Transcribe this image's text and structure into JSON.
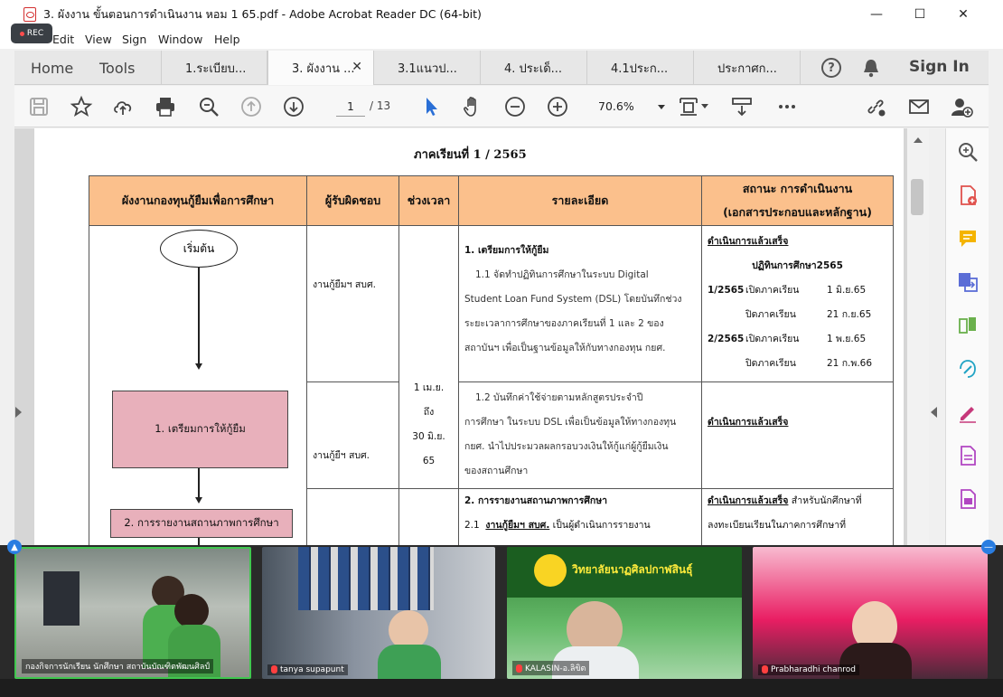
{
  "window": {
    "title": "3. ผังงาน ขั้นตอนการดำเนินงาน หอม 1 65.pdf - Adobe Acrobat Reader DC (64-bit)",
    "rec_label": "REC",
    "minimize": "—",
    "maximize": "☐",
    "close": "✕"
  },
  "menu": [
    "Edit",
    "View",
    "Sign",
    "Window",
    "Help"
  ],
  "nav": {
    "home": "Home",
    "tools": "Tools",
    "sign_in": "Sign In",
    "help": "?"
  },
  "tabs": [
    {
      "label": "1.ระเบียบ..."
    },
    {
      "label": "3. ผังงาน ...",
      "active": true,
      "close": "✕"
    },
    {
      "label": "3.1แนวป..."
    },
    {
      "label": "4. ประเด็..."
    },
    {
      "label": "4.1ประก..."
    },
    {
      "label": "ประกาศก..."
    }
  ],
  "toolbar": {
    "page_current": "1",
    "page_total": "/ 13",
    "zoom": "70.6%"
  },
  "document": {
    "semester": "ภาคเรียนที่ 1 / 2565",
    "headers": [
      "ผังงานกองทุนกู้ยืมเพื่อการศึกษา",
      "ผู้รับผิดชอบ",
      "ช่วงเวลา",
      "รายละเอียด",
      "สถานะ การดำเนินงาน",
      "(เอกสารประกอบและหลักฐาน)"
    ],
    "flow": {
      "start": "เริ่มต้น",
      "step1": "1. เตรียมการให้กู้ยืม",
      "step2": "2. การรายงานสถานภาพการศึกษา"
    },
    "responsible": [
      "งานกู้ยืมฯ สบศ.",
      "งานกู้ยืฯ สบศ."
    ],
    "period": [
      "1 เม.ย.",
      "ถึง",
      "30 มิ.ย.",
      "65"
    ],
    "detail1": {
      "heading": "1. เตรียมการให้กู้ยืม",
      "lines": [
        "1.1  จัดทำปฏิทินการศึกษาในระบบ Digital",
        "Student Loan Fund System  (DSL) โดยบันทึกช่วง",
        "ระยะเวลาการศึกษาของภาคเรียนที่ 1 และ 2 ของ",
        "สถาบันฯ เพื่อเป็นฐานข้อมูลให้กับทางกองทุน กยศ."
      ]
    },
    "detail2": {
      "lines": [
        "1.2   บันทึกค่าใช้จ่ายตามหลักสูตรประจำปี",
        "การศึกษา ในระบบ DSL เพื่อเป็นข้อมูลให้ทางกองทุน",
        "กยศ. นำไปประมวลผลกรอบวงเงินให้กู้แก่ผู้กู้ยืมเงิน",
        "ของสถานศึกษา"
      ]
    },
    "detail3": {
      "heading": "2.  การรายงานสถานภาพการศึกษา",
      "num": "2.1",
      "underlined": "งานกู้ยืมฯ สบศ.",
      "rest": "เป็นผู้ดำเนินการรายงาน"
    },
    "status1": {
      "done": "ดำเนินการแล้วเสร็จ",
      "calendar_title": "ปฏิทินการศึกษา2565",
      "rows": [
        {
          "term": "1/2565",
          "label": "เปิดภาคเรียน",
          "date": "1 มิ.ย.65"
        },
        {
          "term": "",
          "label": "ปิดภาคเรียน",
          "date": "21 ก.ย.65"
        },
        {
          "term": "2/2565",
          "label": "เปิดภาคเรียน",
          "date": "1 พ.ย.65"
        },
        {
          "term": "",
          "label": "ปิดภาคเรียน",
          "date": "21 ก.พ.66"
        }
      ]
    },
    "status2": {
      "done": "ดำเนินการแล้วเสร็จ"
    },
    "status3": {
      "done": "ดำเนินการแล้วเสร็จ",
      "rest": "สำหรับนักศึกษาที่",
      "line2": "ลงทะเบียนเรียนในภาคการศึกษาที่"
    }
  },
  "participants": [
    {
      "name": "กองกิจการนักเรียน นักศึกษา สถาบันบัณฑิตพัฒนศิลป์",
      "muted": false,
      "active": true
    },
    {
      "name": "tanya supapunt",
      "muted": true
    },
    {
      "name": "KALASIN-อ.ลิขิต",
      "muted": true,
      "banner": "วิทยาลัยนาฏศิลปกาฬสินธุ์"
    },
    {
      "name": "Prabharadhi chanrod",
      "muted": true
    }
  ],
  "colors": {
    "header_bg": "#fbc08c",
    "flow_box": "#e8b0bb",
    "active_speaker": "#40c74f",
    "acrobat_red": "#d32f2f"
  }
}
